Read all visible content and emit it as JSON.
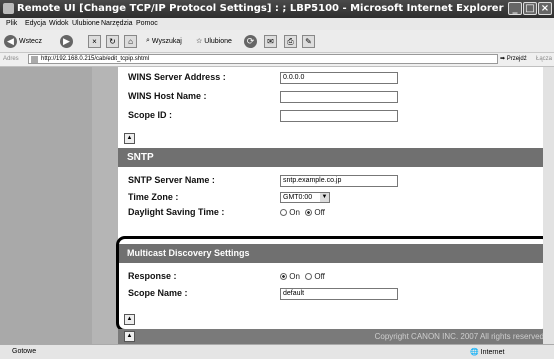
{
  "window": {
    "title": "Remote UI [Change TCP/IP Protocol Settings] : ; LBP5100 - Microsoft Internet Explorer"
  },
  "menu": [
    "Plik",
    "Edycja",
    "Widok",
    "Ulubione",
    "Narzędzia",
    "Pomoc"
  ],
  "toolbar": {
    "back": "Wstecz",
    "search": "Wyszukaj",
    "favorites": "Ulubione"
  },
  "address": {
    "label": "Adres",
    "url": "http://192.168.0.215/cab/edit_tcpip.shtml",
    "go": "Przejdź",
    "links": "Łącza"
  },
  "wins": {
    "server_label": "WINS Server Address :",
    "server_value": "0.0.0.0",
    "host_label": "WINS Host Name :",
    "host_value": "",
    "scope_label": "Scope ID :",
    "scope_value": ""
  },
  "sntp": {
    "header": "SNTP",
    "server_label": "SNTP Server Name :",
    "server_value": "sntp.example.co.jp",
    "timezone_label": "Time Zone :",
    "timezone_value": "GMT0:00",
    "dst_label": "Daylight Saving Time :",
    "on": "On",
    "off": "Off"
  },
  "multicast": {
    "header": "Multicast Discovery Settings",
    "response_label": "Response :",
    "on": "On",
    "off": "Off",
    "scope_label": "Scope Name :",
    "scope_value": "default"
  },
  "footer": {
    "copyright": "Copyright CANON INC. 2007 All rights reserved"
  },
  "status": {
    "left": "Gotowe",
    "zone": "Internet"
  }
}
